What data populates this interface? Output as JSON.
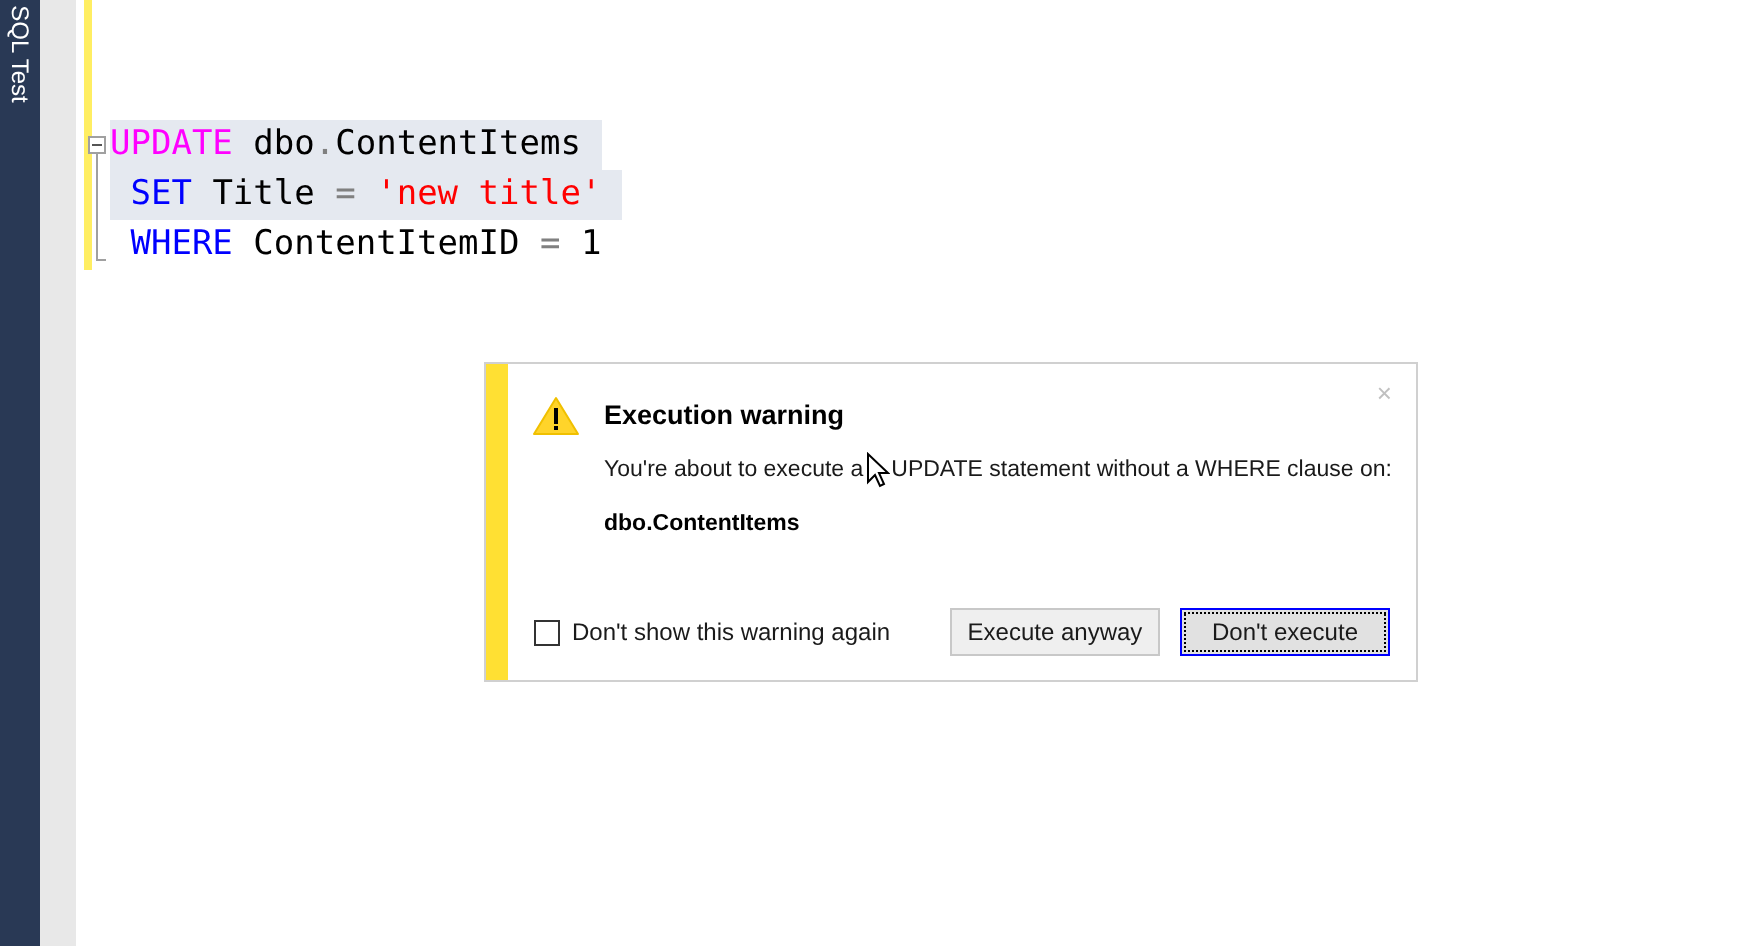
{
  "side_tab": {
    "label": "SQL Test"
  },
  "editor": {
    "lines": [
      {
        "selected": true,
        "tokens": [
          {
            "kind": "dml",
            "text": "UPDATE"
          },
          {
            "kind": "plain",
            "text": " dbo"
          },
          {
            "kind": "operator",
            "text": "."
          },
          {
            "kind": "plain",
            "text": "ContentItems "
          }
        ]
      },
      {
        "selected": true,
        "tokens": [
          {
            "kind": "keyword",
            "text": " SET"
          },
          {
            "kind": "plain",
            "text": " Title "
          },
          {
            "kind": "operator",
            "text": "= "
          },
          {
            "kind": "string",
            "text": "'new title' "
          }
        ]
      },
      {
        "selected": false,
        "tokens": [
          {
            "kind": "keyword",
            "text": " WHERE"
          },
          {
            "kind": "plain",
            "text": " ContentItemID "
          },
          {
            "kind": "operator",
            "text": "="
          },
          {
            "kind": "plain",
            "text": " 1"
          }
        ]
      }
    ]
  },
  "dialog": {
    "title": "Execution warning",
    "close": "×",
    "message_parts": [
      "You're about to execute a",
      "UPDATE statement without a WHERE clause on:"
    ],
    "object_name": "dbo.ContentItems",
    "checkbox": {
      "label": "Don't show this warning again",
      "checked": false
    },
    "buttons": [
      {
        "label": "Execute anyway",
        "focused": false
      },
      {
        "label": "Don't execute",
        "focused": true
      }
    ]
  }
}
